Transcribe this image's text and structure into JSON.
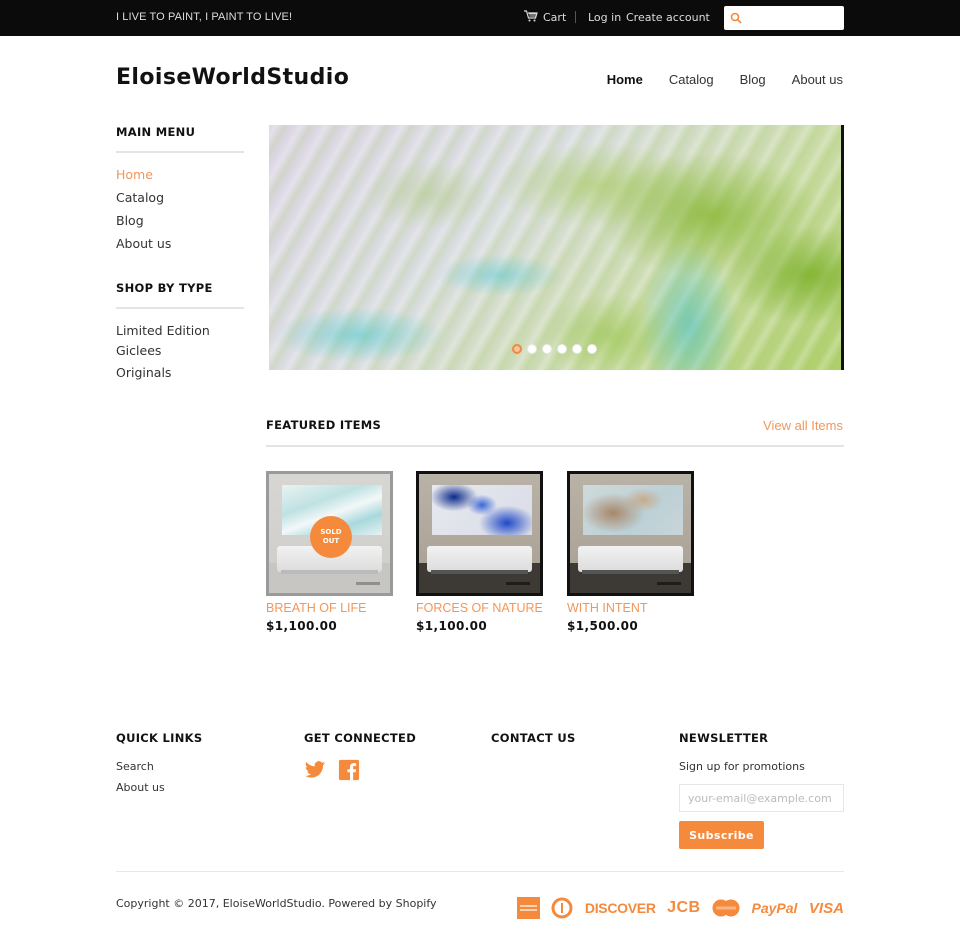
{
  "topbar": {
    "tagline": "I LIVE TO PAINT, I PAINT TO LIVE!",
    "cart_label": "Cart",
    "login_label": "Log in",
    "create_account_label": "Create account",
    "search_placeholder": ""
  },
  "header": {
    "logo": "EloiseWorldStudio",
    "nav": [
      {
        "label": "Home",
        "active": true
      },
      {
        "label": "Catalog"
      },
      {
        "label": "Blog"
      },
      {
        "label": "About us"
      }
    ]
  },
  "sidebar": {
    "main_menu": {
      "heading": "MAIN MENU",
      "items": [
        "Home",
        "Catalog",
        "Blog",
        "About us"
      ],
      "active_index": 0
    },
    "shop_by_type": {
      "heading": "SHOP BY TYPE",
      "items": [
        "Limited Edition",
        "Giclees",
        "Originals"
      ]
    }
  },
  "slideshow": {
    "slide_count": 6,
    "active_slide": 1
  },
  "featured": {
    "heading": "FEATURED ITEMS",
    "view_all_label": "View all Items",
    "products": [
      {
        "name": "BREATH OF LIFE",
        "price": "$1,100.00",
        "sold_out": true,
        "badge": "SOLD OUT",
        "art_palette": "aqua"
      },
      {
        "name": "FORCES OF NATURE",
        "price": "$1,100.00",
        "sold_out": false,
        "art_palette": "blue"
      },
      {
        "name": "WITH INTENT",
        "price": "$1,500.00",
        "sold_out": false,
        "art_palette": "tan"
      }
    ]
  },
  "footer": {
    "quick_links": {
      "heading": "QUICK LINKS",
      "items": [
        "Search",
        "About us"
      ]
    },
    "get_connected": {
      "heading": "GET CONNECTED",
      "icons": [
        "twitter-icon",
        "facebook-icon"
      ]
    },
    "contact_us": {
      "heading": "CONTACT US"
    },
    "newsletter": {
      "heading": "NEWSLETTER",
      "text": "Sign up for promotions",
      "email_placeholder": "your-email@example.com",
      "email_value": "",
      "subscribe_label": "Subscribe"
    },
    "copyright_prefix": "Copyright © 2017, ",
    "copyright_brand": "EloiseWorldStudio",
    "copyright_suffix": ". ",
    "powered_by": "Powered by Shopify",
    "payment_methods": [
      "American Express",
      "Diners Club",
      "DISCOVER",
      "JCB",
      "MasterCard",
      "PayPal",
      "VISA"
    ]
  },
  "colors": {
    "accent": "#f58a3d",
    "link_accent": "#f0975a",
    "topbar_bg": "#0b0b0b",
    "text": "#333333"
  }
}
